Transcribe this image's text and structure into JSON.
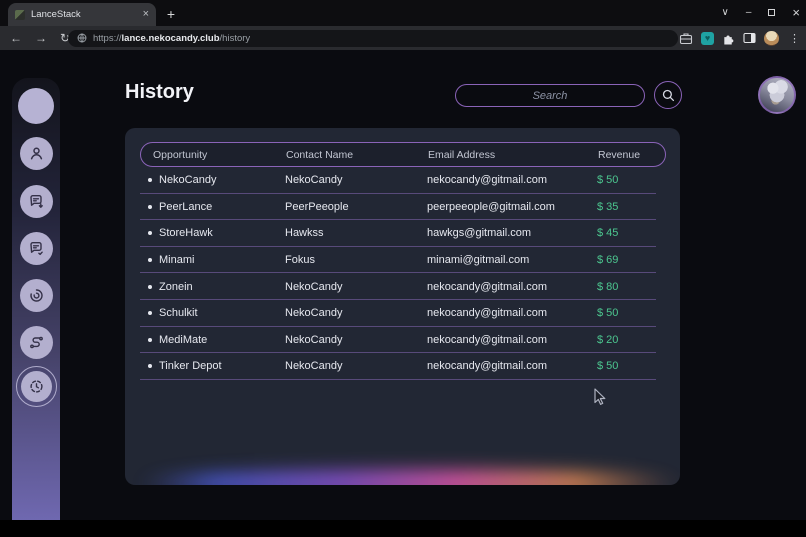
{
  "browser": {
    "tab_title": "LanceStack",
    "glyphs": {
      "close_tab": "×",
      "new_tab": "+",
      "back": "←",
      "forward": "→",
      "reload": "↻",
      "minimize": "–",
      "chevron": "∨",
      "close_window": "×",
      "menu_dots": "⋮",
      "heart_extension": "♥"
    },
    "url": {
      "protocol": "https://",
      "domain": "lance.nekocandy.club",
      "path": "/history"
    }
  },
  "page": {
    "title": "History",
    "search": {
      "placeholder": "Search"
    },
    "table": {
      "columns": [
        "Opportunity",
        "Contact Name",
        "Email Address",
        "Revenue"
      ],
      "rows": [
        {
          "opportunity": "NekoCandy",
          "contact": "NekoCandy",
          "email": "nekocandy@gitmail.com",
          "revenue": "$ 50"
        },
        {
          "opportunity": "PeerLance",
          "contact": "PeerPeeople",
          "email": "peerpeeople@gitmail.com",
          "revenue": "$ 35"
        },
        {
          "opportunity": "StoreHawk",
          "contact": "Hawkss",
          "email": "hawkgs@gitmail.com",
          "revenue": "$ 45"
        },
        {
          "opportunity": "Minami",
          "contact": "Fokus",
          "email": "minami@gitmail.com",
          "revenue": "$ 69"
        },
        {
          "opportunity": "Zonein",
          "contact": "NekoCandy",
          "email": "nekocandy@gitmail.com",
          "revenue": "$ 80"
        },
        {
          "opportunity": "Schulkit",
          "contact": "NekoCandy",
          "email": "nekocandy@gitmail.com",
          "revenue": "$ 50"
        },
        {
          "opportunity": "MediMate",
          "contact": "NekoCandy",
          "email": "nekocandy@gitmail.com",
          "revenue": "$ 20"
        },
        {
          "opportunity": "Tinker Depot",
          "contact": "NekoCandy",
          "email": "nekocandy@gitmail.com",
          "revenue": "$ 50"
        }
      ]
    }
  },
  "sidebar": {
    "items": [
      "logo",
      "profile",
      "messages-incoming",
      "messages-done",
      "activity",
      "flow",
      "history"
    ],
    "active_item": "history"
  },
  "colors": {
    "accent_purple": "#8a63b8",
    "revenue_green": "#4cc68f",
    "sidebar_bottom": "#6f68b0",
    "glow_blue": "#4c5cd8",
    "glow_violet": "#8a52cc",
    "glow_pink": "#de58ab",
    "glow_orange": "#ea8f58"
  }
}
